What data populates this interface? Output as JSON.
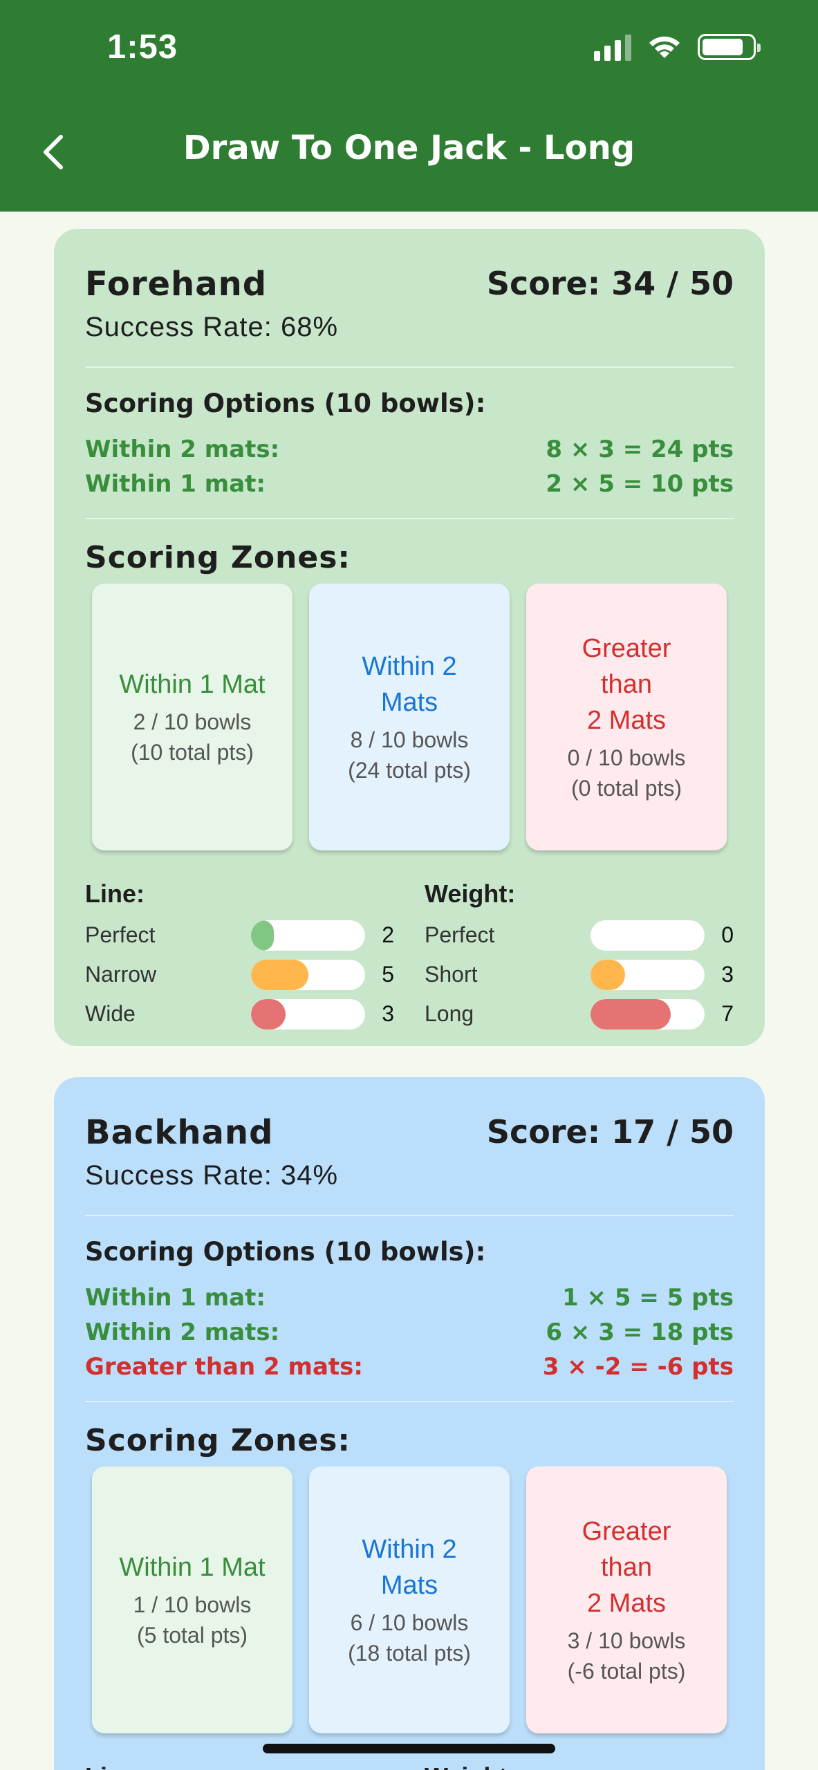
{
  "status_bar": {
    "time": "1:53"
  },
  "header": {
    "title": "Draw To One Jack - Long"
  },
  "colors": {
    "header": "#2e7d32",
    "forehand_card": "#c8e6c9",
    "backhand_card": "#bbdefb",
    "green_text": "#388e3c",
    "red_text": "#d32f2f",
    "blue_text": "#1976d2",
    "bar_perfect": "#81c784",
    "bar_narrow_short": "#ffb74d",
    "bar_wide_long": "#e57373"
  },
  "forehand": {
    "title": "Forehand",
    "score": "Score: 34 / 50",
    "rate": "Success Rate: 68%",
    "options_title": "Scoring Options (10 bowls):",
    "options": [
      {
        "label": "Within 2 mats:",
        "value": "8 × 3 = 24 pts",
        "color": "green"
      },
      {
        "label": "Within 1 mat:",
        "value": "2 × 5 = 10 pts",
        "color": "green"
      }
    ],
    "zones_title": "Scoring Zones:",
    "zones": [
      {
        "name": "Within 1 Mat",
        "bowls": "2 / 10 bowls",
        "pts": "(10 total pts)"
      },
      {
        "name": "Within 2\nMats",
        "bowls": "8 / 10 bowls",
        "pts": "(24 total pts)"
      },
      {
        "name": "Greater\nthan\n2 Mats",
        "bowls": "0 / 10 bowls",
        "pts": "(0 total pts)"
      }
    ],
    "line": {
      "title": "Line:",
      "rows": [
        {
          "label": "Perfect",
          "count": "2",
          "fraction": 0.2
        },
        {
          "label": "Narrow",
          "count": "5",
          "fraction": 0.5
        },
        {
          "label": "Wide",
          "count": "3",
          "fraction": 0.3
        }
      ]
    },
    "weight": {
      "title": "Weight:",
      "rows": [
        {
          "label": "Perfect",
          "count": "0",
          "fraction": 0.0
        },
        {
          "label": "Short",
          "count": "3",
          "fraction": 0.3
        },
        {
          "label": "Long",
          "count": "7",
          "fraction": 0.7
        }
      ]
    }
  },
  "backhand": {
    "title": "Backhand",
    "score": "Score: 17 / 50",
    "rate": "Success Rate: 34%",
    "options_title": "Scoring Options (10 bowls):",
    "options": [
      {
        "label": "Within 1 mat:",
        "value": "1 × 5 = 5 pts",
        "color": "green"
      },
      {
        "label": "Within 2 mats:",
        "value": "6 × 3 = 18 pts",
        "color": "green"
      },
      {
        "label": "Greater than 2 mats:",
        "value": "3 × -2 = -6 pts",
        "color": "red"
      }
    ],
    "zones_title": "Scoring Zones:",
    "zones": [
      {
        "name": "Within 1 Mat",
        "bowls": "1 / 10 bowls",
        "pts": "(5 total pts)"
      },
      {
        "name": "Within 2\nMats",
        "bowls": "6 / 10 bowls",
        "pts": "(18 total pts)"
      },
      {
        "name": "Greater\nthan\n2 Mats",
        "bowls": "3 / 10 bowls",
        "pts": "(-6 total pts)"
      }
    ],
    "line": {
      "title": "Line:"
    },
    "weight": {
      "title": "Weight:"
    }
  }
}
